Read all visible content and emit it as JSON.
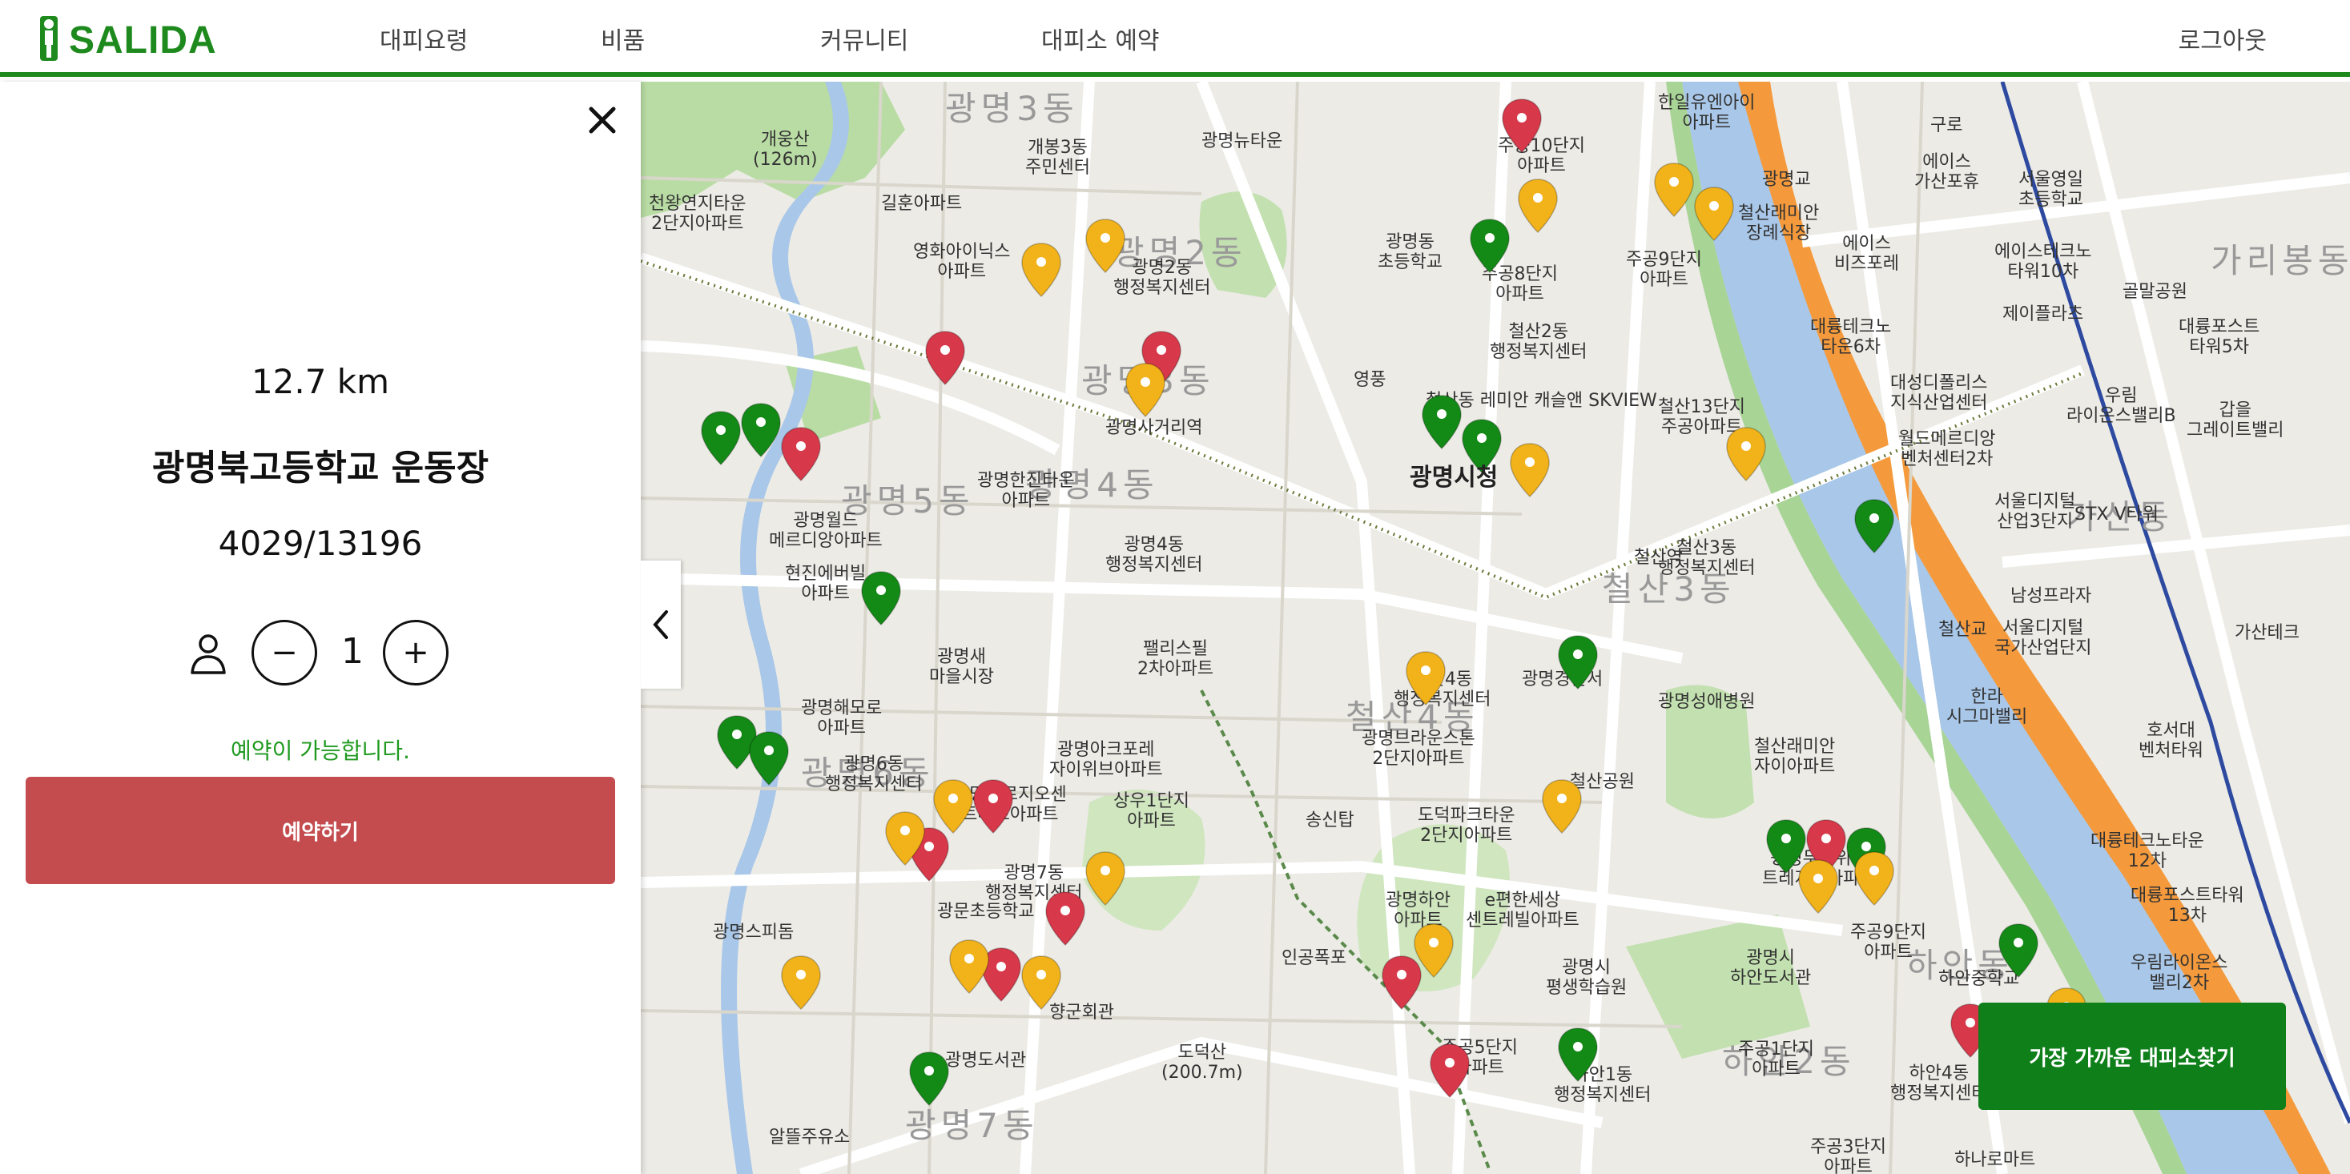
{
  "header": {
    "logo_text": "SALIDA",
    "nav": [
      "대피요령",
      "비품",
      "커뮤니티",
      "대피소 예약"
    ],
    "logout_label": "로그아웃"
  },
  "panel": {
    "close_icon": "close-icon",
    "distance": "12.7 km",
    "shelter_name": "광명북고등학교 운동장",
    "capacity": "4029/13196",
    "person_icon": "person-icon",
    "minus_label": "−",
    "quantity": "1",
    "plus_label": "+",
    "status": "예약이 가능합니다.",
    "reserve_label": "예약하기"
  },
  "map": {
    "nearest_label": "가장 가까운 대피소찾기",
    "labels": [
      {
        "text": "개웅산\n(126m)"
      },
      {
        "text": "개봉3동\n주민센터"
      },
      {
        "text": "광명뉴타운"
      },
      {
        "text": "주공10단지\n아파트"
      },
      {
        "text": "한일유엔아이\n아파트"
      },
      {
        "text": "구로"
      },
      {
        "text": "천왕연지타운\n2단지아파트"
      },
      {
        "text": "길훈아파트"
      },
      {
        "text": "영화아이닉스\n아파트"
      },
      {
        "text": "광명2동\n행정복지센터"
      },
      {
        "text": "광명동\n초등학교"
      },
      {
        "text": "주공8단지\n아파트"
      },
      {
        "text": "주공9단지\n아파트"
      },
      {
        "text": "철산2동\n행정복지센터"
      },
      {
        "text": "광명교"
      },
      {
        "text": "철산래미안\n장례식장"
      },
      {
        "text": "에이스\n가산포휴"
      },
      {
        "text": "서울영일\n초등학교"
      },
      {
        "text": "에이스\n비즈포레"
      },
      {
        "text": "에이스테크노\n타워10차"
      },
      {
        "text": "제이플라츠"
      },
      {
        "text": "골말공원"
      },
      {
        "text": "대륭테크노\n타운6차"
      },
      {
        "text": "대성디폴리스\n지식산업센터"
      },
      {
        "text": "대륭포스트\n타워5차"
      },
      {
        "text": "광명시청"
      },
      {
        "text": "철산13단지\n주공아파트"
      },
      {
        "text": "월드메르디앙\n벤처센터2차"
      },
      {
        "text": "우림\n라이온스밸리B"
      },
      {
        "text": "갑을\n그레이트밸리"
      },
      {
        "text": "광명한진타운\n아파트"
      },
      {
        "text": "광명월드\n메르디앙아파트"
      },
      {
        "text": "광명4동\n행정복지센터"
      },
      {
        "text": "철산3동\n행정복지센터"
      },
      {
        "text": "서울디지털\n산업3단지"
      },
      {
        "text": "STX V타워"
      },
      {
        "text": "현진에버빌\n아파트"
      },
      {
        "text": "남성프라자"
      },
      {
        "text": "철산교"
      },
      {
        "text": "서울디지털\n국가산업단지"
      },
      {
        "text": "가산테크"
      },
      {
        "text": "광명새\n마을시장"
      },
      {
        "text": "팰리스필\n2차아파트"
      },
      {
        "text": "철산4동\n행정복지센터"
      },
      {
        "text": "광명경찰서"
      },
      {
        "text": "광명성애병원"
      },
      {
        "text": "한라\n시그마밸리"
      },
      {
        "text": "호서대\n벤처타워"
      },
      {
        "text": "광명해모로\n아파트"
      },
      {
        "text": "광명아크포레\n자이위브아파트"
      },
      {
        "text": "광명브라운스톤\n2단지아파트"
      },
      {
        "text": "철산공원"
      },
      {
        "text": "철산래미안\n자이아파트"
      },
      {
        "text": "광명6동\n행정복지센터"
      },
      {
        "text": "광명푸르지오센\n트베르아파트"
      },
      {
        "text": "상우1단지\n아파트"
      },
      {
        "text": "도덕파크타운\n2단지아파트"
      },
      {
        "text": "광명두산위브\n트레지움아파트"
      },
      {
        "text": "대륭테크노타운\n12차"
      },
      {
        "text": "송신탑"
      },
      {
        "text": "광명7동\n행정복지센터"
      },
      {
        "text": "e편한세상\n센트레빌아파트"
      },
      {
        "text": "광명하안\n아파트"
      },
      {
        "text": "주공9단지\n아파트"
      },
      {
        "text": "대륭포스트타워\n13차"
      },
      {
        "text": "광명스피돔"
      },
      {
        "text": "광문초등학교"
      },
      {
        "text": "인공폭포"
      },
      {
        "text": "광명시\n평생학습원"
      },
      {
        "text": "광명시\n하안도서관"
      },
      {
        "text": "하안중학교"
      },
      {
        "text": "우림라이온스\n밸리2차"
      },
      {
        "text": "향군회관"
      },
      {
        "text": "도덕산\n(200.7m)"
      },
      {
        "text": "주공5단지\n아파트"
      },
      {
        "text": "하안1동\n행정복지센터"
      },
      {
        "text": "주공1단지\n아파트"
      },
      {
        "text": "하안4동\n행정복지센터"
      },
      {
        "text": "광명도서관"
      },
      {
        "text": "알뜰주유소"
      },
      {
        "text": "주공3단지\n아파트"
      },
      {
        "text": "하나로마트"
      },
      {
        "text": "광명사거리역"
      },
      {
        "text": "철산역"
      },
      {
        "text": "영풍"
      },
      {
        "text": "철산동 레미안 캐슬앤 SKVIEW"
      }
    ],
    "district_labels": [
      "광명3동",
      "광명2동",
      "광명3동",
      "광명5동",
      "광명4동",
      "철산3동",
      "가산동",
      "가리봉동",
      "철산4동",
      "광명6동",
      "광명7동",
      "하안동",
      "하안2동"
    ],
    "pin_colors": {
      "green": "#138a16",
      "yellow": "#f2b31a",
      "red": "#d7384a"
    }
  }
}
